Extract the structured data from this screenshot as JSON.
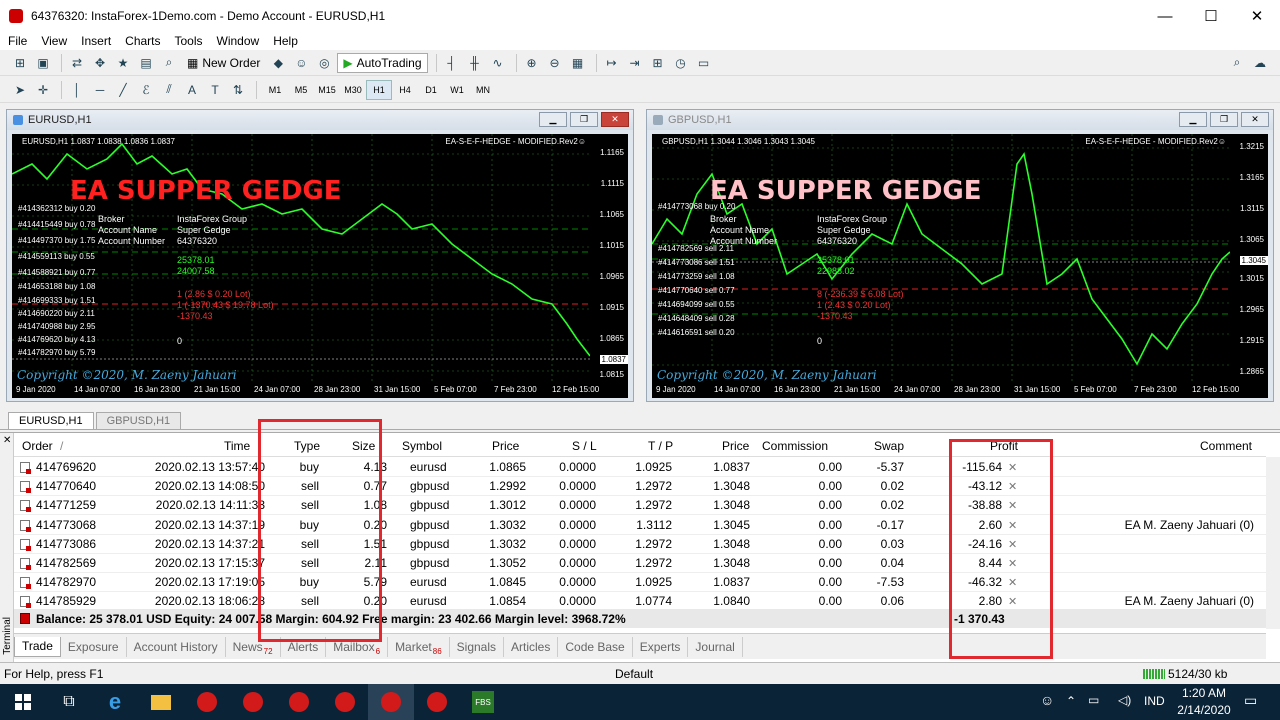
{
  "window": {
    "title": "64376320: InstaForex-1Demo.com - Demo Account - EURUSD,H1",
    "minimize": "—",
    "maximize": "☐",
    "close": "✕"
  },
  "menu": [
    "File",
    "View",
    "Insert",
    "Charts",
    "Tools",
    "Window",
    "Help"
  ],
  "toolbar": {
    "new_order": "New Order",
    "autotrading": "AutoTrading",
    "timeframes": [
      "M1",
      "M5",
      "M15",
      "M30",
      "H1",
      "H4",
      "D1",
      "W1",
      "MN"
    ],
    "active_timeframe": "H1"
  },
  "charts": [
    {
      "tab": "EURUSD,H1",
      "header": "EURUSD,H1  1.0837 1.0838 1.0836 1.0837",
      "ea_label": "EA-S-E-F-HEDGE - MODIFIED.Rev2☺",
      "big_title": "EA SUPPER GEDGE",
      "big_title_color": "#ff2020",
      "info_labels": [
        "Broker",
        "Account Name",
        "Account Number"
      ],
      "info_values": [
        "InstaForex Group",
        "Super Gedge",
        "64376320"
      ],
      "balance": "25378.01",
      "equity": "24007.58",
      "orders": [
        "#414362312 buy 0.20",
        "#414415449 buy 0.78",
        "#414497370 buy 1.75",
        "#414559113 buy 0.55",
        "#414588921 buy 0.77",
        "#414653188 buy 1.08",
        "#414699333 buy 1.51",
        "#414690220 buy 2.11",
        "#414740988 buy 2.95",
        "#414769620 buy 4.13",
        "#414782970 buy 5.79"
      ],
      "buy_line": "1 (2.86 $ 0.20 Lot)",
      "sell_line": "1 (-1370.43 $ 19.78 Lot)",
      "profit_line": "-1370.43",
      "follow": "0",
      "copyright": "Copyright ©2020, M. Zaeny Jahuari",
      "x_ticks": [
        "9 Jan 2020",
        "14 Jan 07:00",
        "16 Jan 23:00",
        "21 Jan 15:00",
        "24 Jan 07:00",
        "28 Jan 23:00",
        "31 Jan 15:00",
        "5 Feb 07:00",
        "7 Feb 23:00",
        "12 Feb 15:00"
      ],
      "y_ticks": [
        "1.1165",
        "1.1115",
        "1.1065",
        "1.1015",
        "1.0965",
        "1.0915",
        "1.0865",
        "1.0815"
      ],
      "price_tag": "1.0837"
    },
    {
      "tab": "GBPUSD,H1",
      "header": "GBPUSD,H1  1.3044 1.3046 1.3043 1.3045",
      "ea_label": "EA-S-E-F-HEDGE - MODIFIED.Rev2☺",
      "big_title": "EA SUPPER GEDGE",
      "big_title_color": "#ffc0c8",
      "info_labels": [
        "Broker",
        "Account Name",
        "Account Number"
      ],
      "info_values": [
        "InstaForex Group",
        "Super Gedge",
        "64376320"
      ],
      "balance": "25378.01",
      "equity": "22988.02",
      "orders": [
        "#414773068 buy 0.20",
        "#414782569 sell 2.11",
        "#414773086 sell 1.51",
        "#414773259 sell 1.08",
        "#414770640 sell 0.77",
        "#414694099 sell 0.55",
        "#414648409 sell 0.28",
        "#414616591 sell 0.20"
      ],
      "buy_line": "8 (-236.39 $ 6.08 Lot)",
      "sell_line": "1 (2.43 $ 0.20 Lot)",
      "profit_line": "-1370.43",
      "follow": "0",
      "copyright": "Copyright ©2020, M. Zaeny Jahuari",
      "x_ticks": [
        "9 Jan 2020",
        "14 Jan 07:00",
        "16 Jan 23:00",
        "21 Jan 15:00",
        "24 Jan 07:00",
        "28 Jan 23:00",
        "31 Jan 15:00",
        "5 Feb 07:00",
        "7 Feb 23:00",
        "12 Feb 15:00"
      ],
      "y_ticks": [
        "1.3215",
        "1.3165",
        "1.3115",
        "1.3065",
        "1.3015",
        "1.2965",
        "1.2915",
        "1.2865"
      ],
      "price_tag": "1.3045"
    }
  ],
  "chart_tabs": [
    "EURUSD,H1",
    "GBPUSD,H1"
  ],
  "terminal": {
    "side_label": "Terminal",
    "headers": {
      "order": "Order",
      "sort": "/",
      "time": "Time",
      "type": "Type",
      "size": "Size",
      "symbol": "Symbol",
      "price": "Price",
      "sl": "S / L",
      "tp": "T / P",
      "price2": "Price",
      "commission": "Commission",
      "swap": "Swap",
      "profit": "Profit",
      "comment": "Comment"
    },
    "rows": [
      {
        "order": "414769620",
        "time": "2020.02.13 13:57:40",
        "type": "buy",
        "size": "4.13",
        "symbol": "eurusd",
        "price": "1.0865",
        "sl": "0.0000",
        "tp": "1.0925",
        "price2": "1.0837",
        "commission": "0.00",
        "swap": "-5.37",
        "profit": "-115.64",
        "comment": ""
      },
      {
        "order": "414770640",
        "time": "2020.02.13 14:08:50",
        "type": "sell",
        "size": "0.77",
        "symbol": "gbpusd",
        "price": "1.2992",
        "sl": "0.0000",
        "tp": "1.2972",
        "price2": "1.3048",
        "commission": "0.00",
        "swap": "0.02",
        "profit": "-43.12",
        "comment": ""
      },
      {
        "order": "414771259",
        "time": "2020.02.13 14:11:33",
        "type": "sell",
        "size": "1.08",
        "symbol": "gbpusd",
        "price": "1.3012",
        "sl": "0.0000",
        "tp": "1.2972",
        "price2": "1.3048",
        "commission": "0.00",
        "swap": "0.02",
        "profit": "-38.88",
        "comment": ""
      },
      {
        "order": "414773068",
        "time": "2020.02.13 14:37:19",
        "type": "buy",
        "size": "0.20",
        "symbol": "gbpusd",
        "price": "1.3032",
        "sl": "0.0000",
        "tp": "1.3112",
        "price2": "1.3045",
        "commission": "0.00",
        "swap": "-0.17",
        "profit": "2.60",
        "comment": "EA M. Zaeny Jahuari (0)"
      },
      {
        "order": "414773086",
        "time": "2020.02.13 14:37:21",
        "type": "sell",
        "size": "1.51",
        "symbol": "gbpusd",
        "price": "1.3032",
        "sl": "0.0000",
        "tp": "1.2972",
        "price2": "1.3048",
        "commission": "0.00",
        "swap": "0.03",
        "profit": "-24.16",
        "comment": ""
      },
      {
        "order": "414782569",
        "time": "2020.02.13 17:15:37",
        "type": "sell",
        "size": "2.11",
        "symbol": "gbpusd",
        "price": "1.3052",
        "sl": "0.0000",
        "tp": "1.2972",
        "price2": "1.3048",
        "commission": "0.00",
        "swap": "0.04",
        "profit": "8.44",
        "comment": ""
      },
      {
        "order": "414782970",
        "time": "2020.02.13 17:19:05",
        "type": "buy",
        "size": "5.79",
        "symbol": "eurusd",
        "price": "1.0845",
        "sl": "0.0000",
        "tp": "1.0925",
        "price2": "1.0837",
        "commission": "0.00",
        "swap": "-7.53",
        "profit": "-46.32",
        "comment": ""
      },
      {
        "order": "414785929",
        "time": "2020.02.13 18:06:28",
        "type": "sell",
        "size": "0.20",
        "symbol": "eurusd",
        "price": "1.0854",
        "sl": "0.0000",
        "tp": "1.0774",
        "price2": "1.0840",
        "commission": "0.00",
        "swap": "0.06",
        "profit": "2.80",
        "comment": "EA M. Zaeny Jahuari (0)"
      }
    ],
    "balance_text": "Balance: 25 378.01 USD  Equity: 24 007.58  Margin: 604.92  Free margin: 23 402.66  Margin level: 3968.72%",
    "total_profit": "-1 370.43",
    "tabs": [
      {
        "label": "Trade",
        "badge": ""
      },
      {
        "label": "Exposure",
        "badge": ""
      },
      {
        "label": "Account History",
        "badge": ""
      },
      {
        "label": "News",
        "badge": "72"
      },
      {
        "label": "Alerts",
        "badge": ""
      },
      {
        "label": "Mailbox",
        "badge": "6"
      },
      {
        "label": "Market",
        "badge": "86"
      },
      {
        "label": "Signals",
        "badge": ""
      },
      {
        "label": "Articles",
        "badge": ""
      },
      {
        "label": "Code Base",
        "badge": ""
      },
      {
        "label": "Experts",
        "badge": ""
      },
      {
        "label": "Journal",
        "badge": ""
      }
    ]
  },
  "status": {
    "help": "For Help, press F1",
    "profile": "Default",
    "traffic": "5124/30 kb"
  },
  "taskbar": {
    "lang": "IND",
    "time": "1:20 AM",
    "date": "2/14/2020",
    "fbs": "FBS"
  }
}
